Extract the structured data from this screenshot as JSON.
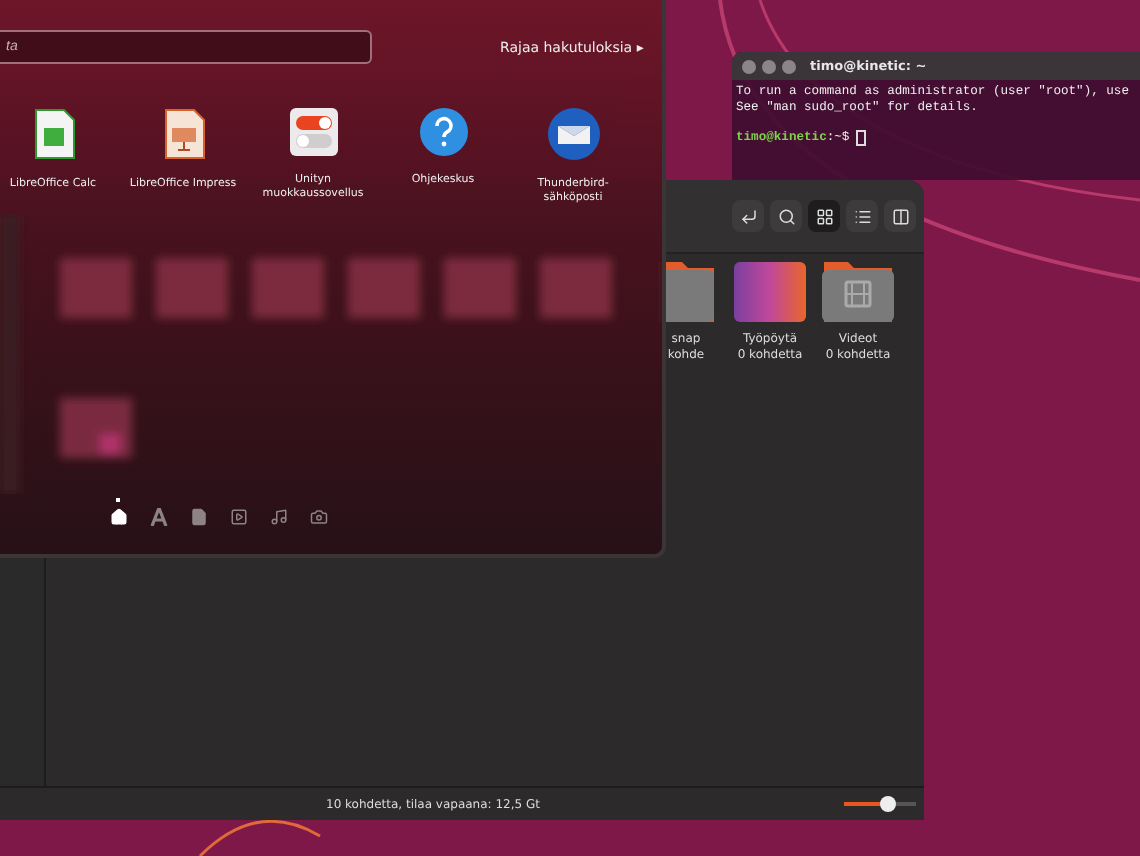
{
  "dash": {
    "search": {
      "placeholder": "ta"
    },
    "filter": {
      "label": "Rajaa hakutuloksia",
      "arrow": "▸"
    },
    "apps": [
      {
        "name": "LibreOffice Calc",
        "kind": "calc"
      },
      {
        "name": "LibreOffice Impress",
        "kind": "impress"
      },
      {
        "name": "Unityn muokkaussovellus",
        "kind": "tweak"
      },
      {
        "name": "Ohjekeskus",
        "kind": "help"
      },
      {
        "name": "Thunderbird-sähköposti",
        "kind": "mail"
      }
    ],
    "lenses": [
      {
        "kind": "home",
        "selected": true
      },
      {
        "kind": "apps",
        "selected": false
      },
      {
        "kind": "files",
        "selected": false
      },
      {
        "kind": "video",
        "selected": false
      },
      {
        "kind": "music",
        "selected": false
      },
      {
        "kind": "photos",
        "selected": false
      }
    ]
  },
  "terminal": {
    "title": "timo@kinetic: ~",
    "lines": [
      "To run a command as administrator (user \"root\"), use",
      "See \"man sudo_root\" for details."
    ],
    "prompt_user": "timo@kinetic",
    "prompt_path": ":~$"
  },
  "file_manager": {
    "items": [
      {
        "name": "snap",
        "count": "kohde",
        "kind": "folder"
      },
      {
        "name": "Työpöytä",
        "count": "0 kohdetta",
        "kind": "desktop"
      },
      {
        "name": "Videot",
        "count": "0 kohdetta",
        "kind": "videos"
      }
    ],
    "status": "10 kohdetta, tilaa vapaana: 12,5 Gt",
    "zoom": {
      "level": 0.62
    }
  }
}
